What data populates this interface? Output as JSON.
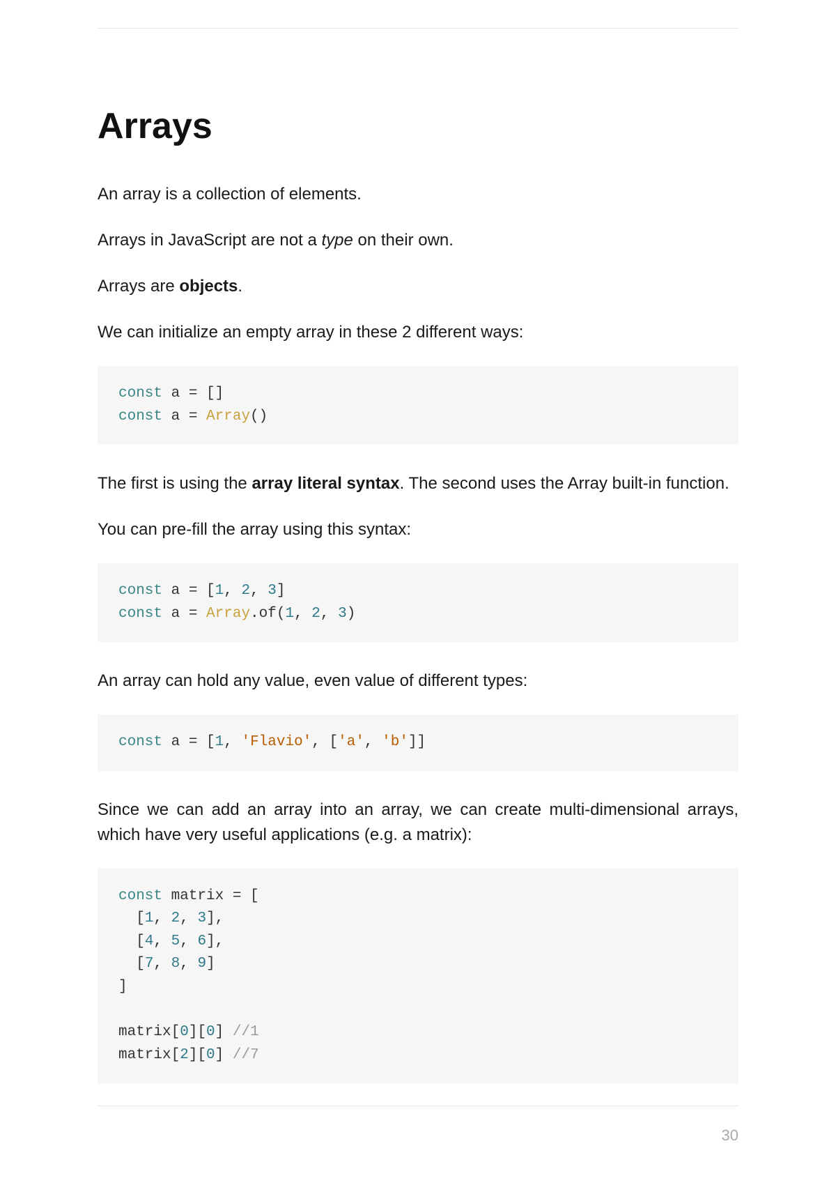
{
  "heading": "Arrays",
  "paragraphs": {
    "p1": "An array is a collection of elements.",
    "p2_a": "Arrays in JavaScript are not a ",
    "p2_em": "type",
    "p2_b": " on their own.",
    "p3_a": "Arrays are ",
    "p3_bold": "objects",
    "p3_b": ".",
    "p4": "We can initialize an empty array in these 2 different ways:",
    "p5_a": "The first is using the ",
    "p5_bold": "array literal syntax",
    "p5_b": ". The second uses the Array built-in function.",
    "p6": "You can pre-fill the array using this syntax:",
    "p7": "An array can hold any value, even value of different types:",
    "p8": "Since we can add an array into an array, we can create multi-dimensional arrays, which have very useful applications (e.g. a matrix):"
  },
  "code": {
    "c1": {
      "kw1": "const",
      "t1": " a = []\n",
      "kw2": "const",
      "t2": " a = ",
      "cls1": "Array",
      "t3": "()"
    },
    "c2": {
      "kw1": "const",
      "t1": " a = [",
      "n1": "1",
      "t2": ", ",
      "n2": "2",
      "t3": ", ",
      "n3": "3",
      "t4": "]\n",
      "kw2": "const",
      "t5": " a = ",
      "cls1": "Array",
      "t6": ".of(",
      "n4": "1",
      "t7": ", ",
      "n5": "2",
      "t8": ", ",
      "n6": "3",
      "t9": ")"
    },
    "c3": {
      "kw1": "const",
      "t1": " a = [",
      "n1": "1",
      "t2": ", ",
      "s1": "'Flavio'",
      "t3": ", [",
      "s2": "'a'",
      "t4": ", ",
      "s3": "'b'",
      "t5": "]]"
    },
    "c4": {
      "kw1": "const",
      "t1": " matrix = [\n  [",
      "n1": "1",
      "t2": ", ",
      "n2": "2",
      "t3": ", ",
      "n3": "3",
      "t4": "],\n  [",
      "n4": "4",
      "t5": ", ",
      "n5": "5",
      "t6": ", ",
      "n6": "6",
      "t7": "],\n  [",
      "n7": "7",
      "t8": ", ",
      "n8": "8",
      "t9": ", ",
      "n9": "9",
      "t10": "]\n]\n\nmatrix[",
      "n10": "0",
      "t11": "][",
      "n11": "0",
      "t12": "] ",
      "cm1": "//1",
      "t13": "\nmatrix[",
      "n12": "2",
      "t14": "][",
      "n13": "0",
      "t15": "] ",
      "cm2": "//7"
    }
  },
  "page_number": "30"
}
